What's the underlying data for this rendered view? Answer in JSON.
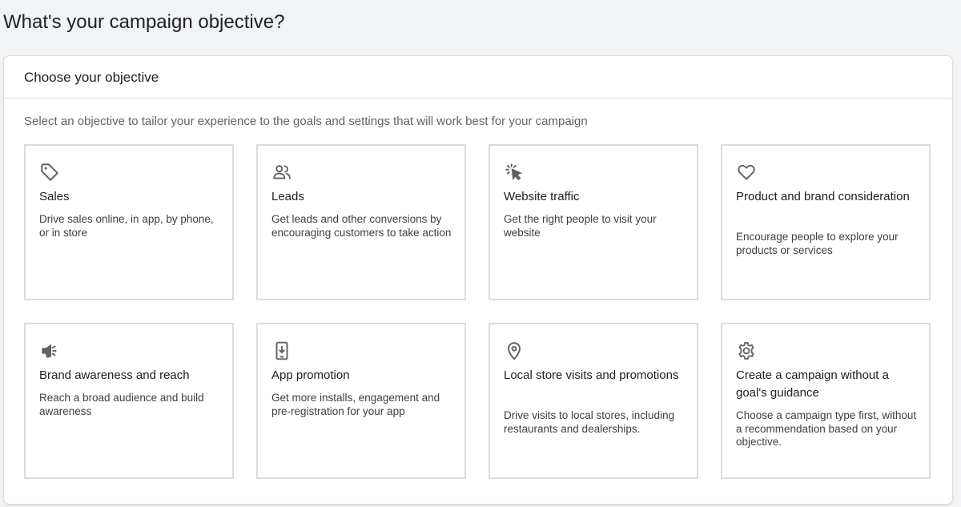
{
  "page": {
    "title": "What's your campaign objective?"
  },
  "panel": {
    "title": "Choose your objective",
    "description": "Select an objective to tailor your experience to the goals and settings that will work best for your campaign"
  },
  "objectives": [
    {
      "icon": "tag-icon",
      "title": "Sales",
      "description": "Drive sales online, in app, by phone, or in store"
    },
    {
      "icon": "people-icon",
      "title": "Leads",
      "description": "Get leads and other conversions by encouraging customers to take action"
    },
    {
      "icon": "cursor-click-icon",
      "title": "Website traffic",
      "description": "Get the right people to visit your website"
    },
    {
      "icon": "heart-icon",
      "title": "Product and brand consideration",
      "description": "Encourage people to explore your products or services"
    },
    {
      "icon": "megaphone-icon",
      "title": "Brand awareness and reach",
      "description": "Reach a broad audience and build awareness"
    },
    {
      "icon": "phone-download-icon",
      "title": "App promotion",
      "description": "Get more installs, engagement and pre-registration for your app"
    },
    {
      "icon": "location-pin-icon",
      "title": "Local store visits and promotions",
      "description": "Drive visits to local stores, including restaurants and dealerships."
    },
    {
      "icon": "gear-icon",
      "title": "Create a campaign without a goal's guidance",
      "description": "Choose a campaign type first, without a recommendation based on your objective."
    }
  ],
  "colors": {
    "background": "#f1f3f4",
    "card_border": "#dadce0",
    "text_primary": "#202124",
    "text_secondary": "#5f6368",
    "icon": "#5f6368"
  }
}
